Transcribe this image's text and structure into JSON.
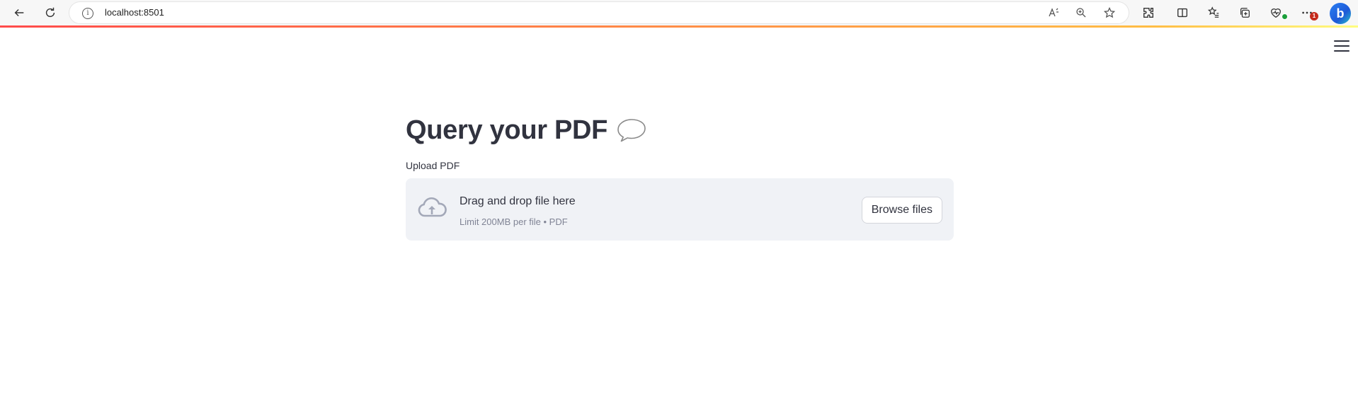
{
  "browser": {
    "url": "localhost:8501",
    "notification_count": "1",
    "profile_button": "b"
  },
  "toolbar_icons": [
    "back-arrow-icon",
    "refresh-icon",
    "info-icon",
    "read-aloud-icon",
    "zoom-icon",
    "favorite-star-icon",
    "extensions-icon",
    "split-screen-icon",
    "favorites-icon",
    "collections-icon",
    "browser-essentials-icon",
    "more-options-icon",
    "bing-copilot-icon"
  ],
  "app": {
    "title": "Query your PDF",
    "title_icon": "speech-bubble-icon",
    "menu_icon": "hamburger-menu-icon"
  },
  "uploader": {
    "label": "Upload PDF",
    "drop_text": "Drag and drop file here",
    "limit_text": "Limit 200MB per file • PDF",
    "browse_label": "Browse files",
    "icon": "cloud-upload-icon"
  },
  "colors": {
    "text": "#31333f",
    "muted": "#808495",
    "dropzone_bg": "#f0f2f6",
    "decoration_start": "#ff4b4b",
    "decoration_end": "#ffbd45"
  }
}
